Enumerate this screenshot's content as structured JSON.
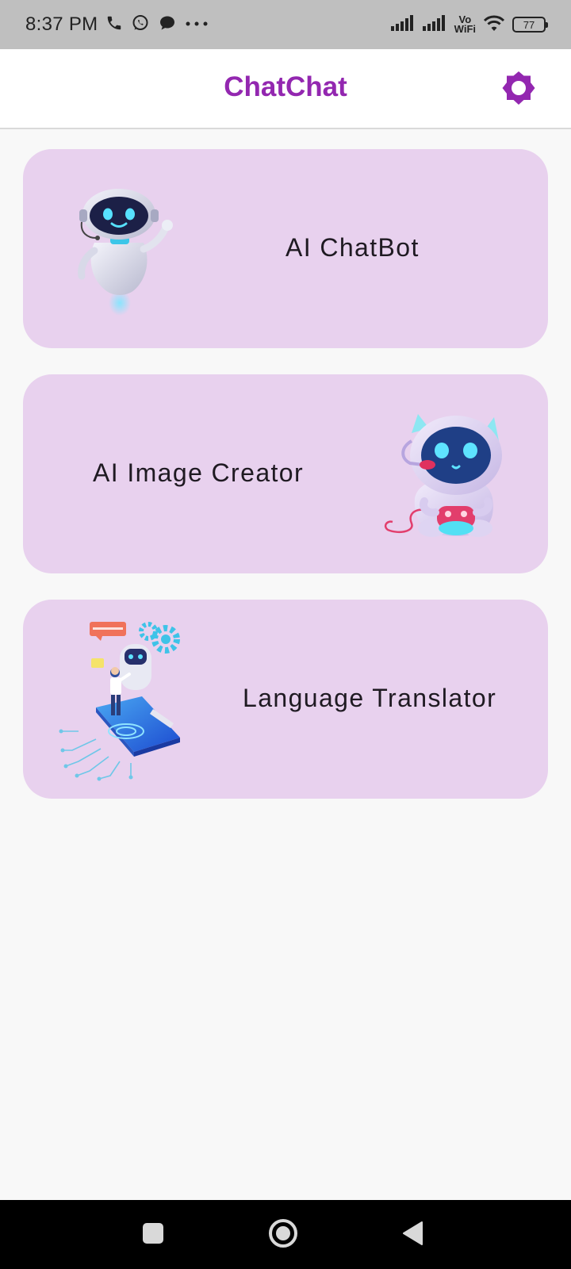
{
  "status_bar": {
    "time": "8:37 PM",
    "vo_wifi_top": "Vo",
    "vo_wifi_bottom": "WiFi",
    "battery": "77",
    "icons": [
      "phone-icon",
      "whatsapp-icon",
      "chat-bubble-icon",
      "more-dots-icon",
      "signal-icon",
      "signal-icon",
      "wifi-icon",
      "battery-icon"
    ]
  },
  "app_bar": {
    "title": "ChatChat",
    "settings_icon": "settings-gear-icon"
  },
  "cards": [
    {
      "label": "AI ChatBot",
      "illustration": "waving-robot-illustration"
    },
    {
      "label": "AI Image Creator",
      "illustration": "sitting-robot-illustration"
    },
    {
      "label": "Language Translator",
      "illustration": "phone-robot-illustration"
    }
  ],
  "nav_bar": {
    "icons": [
      "recents-square-icon",
      "home-circle-icon",
      "back-triangle-icon"
    ]
  },
  "colors": {
    "accent": "#9327b0",
    "card_background": "#e8d1ee",
    "page_background": "#f8f8f8",
    "status_bar": "#bfbfbf",
    "nav_bar": "#000000"
  }
}
